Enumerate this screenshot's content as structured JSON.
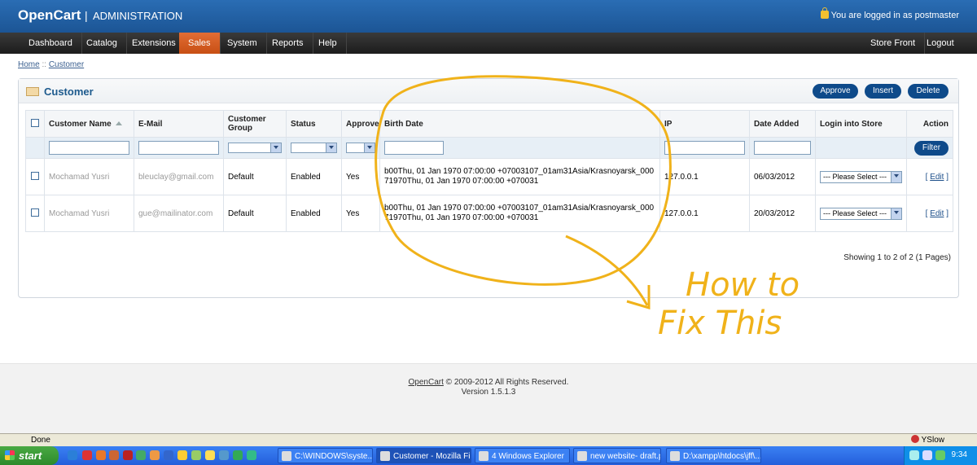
{
  "header": {
    "logo": "OpenCart",
    "separator": "|",
    "subtitle": "ADMINISTRATION",
    "login_text": "You are logged in as postmaster"
  },
  "menu": {
    "items": [
      "Dashboard",
      "Catalog",
      "Extensions",
      "Sales",
      "System",
      "Reports",
      "Help"
    ],
    "active": "Sales",
    "right_items": [
      "Store Front",
      "Logout"
    ]
  },
  "breadcrumb": {
    "home": "Home",
    "sep": " :: ",
    "current": "Customer"
  },
  "box": {
    "title": "Customer",
    "buttons": [
      "Approve",
      "Insert",
      "Delete"
    ]
  },
  "table": {
    "columns": [
      "Customer Name",
      "E-Mail",
      "Customer Group",
      "Status",
      "Approved",
      "Birth Date",
      "IP",
      "Date Added",
      "Login into Store",
      "Action"
    ],
    "filter_button": "Filter",
    "rows": [
      {
        "name": "Mochamad Yusri",
        "email": "bleuclay@gmail.com",
        "group": "Default",
        "status": "Enabled",
        "approved": "Yes",
        "birth_date": "b00Thu, 01 Jan 1970 07:00:00 +07003107_01am31Asia/Krasnoyarsk_00071970Thu, 01 Jan 1970 07:00:00 +070031",
        "ip": "127.0.0.1",
        "date_added": "06/03/2012",
        "login_select": "--- Please Select ---",
        "action": "Edit"
      },
      {
        "name": "Mochamad Yusri",
        "email": "gue@mailinator.com",
        "group": "Default",
        "status": "Enabled",
        "approved": "Yes",
        "birth_date": "b00Thu, 01 Jan 1970 07:00:00 +07003107_01am31Asia/Krasnoyarsk_00071970Thu, 01 Jan 1970 07:00:00 +070031",
        "ip": "127.0.0.1",
        "date_added": "20/03/2012",
        "login_select": "--- Please Select ---",
        "action": "Edit"
      }
    ],
    "pagination": "Showing 1 to 2 of 2 (1 Pages)"
  },
  "annotation": {
    "line1": "How to",
    "line2": "Fix This",
    "color": "#f0b21a"
  },
  "footer": {
    "link": "OpenCart",
    "copyright": " © 2009-2012 All Rights Reserved.",
    "version": "Version 1.5.1.3"
  },
  "statusbar": {
    "status": "Done",
    "addon": "YSlow"
  },
  "taskbar": {
    "start": "start",
    "tasks": [
      "C:\\WINDOWS\\syste...",
      "Customer - Mozilla Fir...",
      "4 Windows Explorer",
      "new website- draft.p...",
      "D:\\xampp\\htdocs\\jff\\..."
    ],
    "clock": "9:34"
  }
}
